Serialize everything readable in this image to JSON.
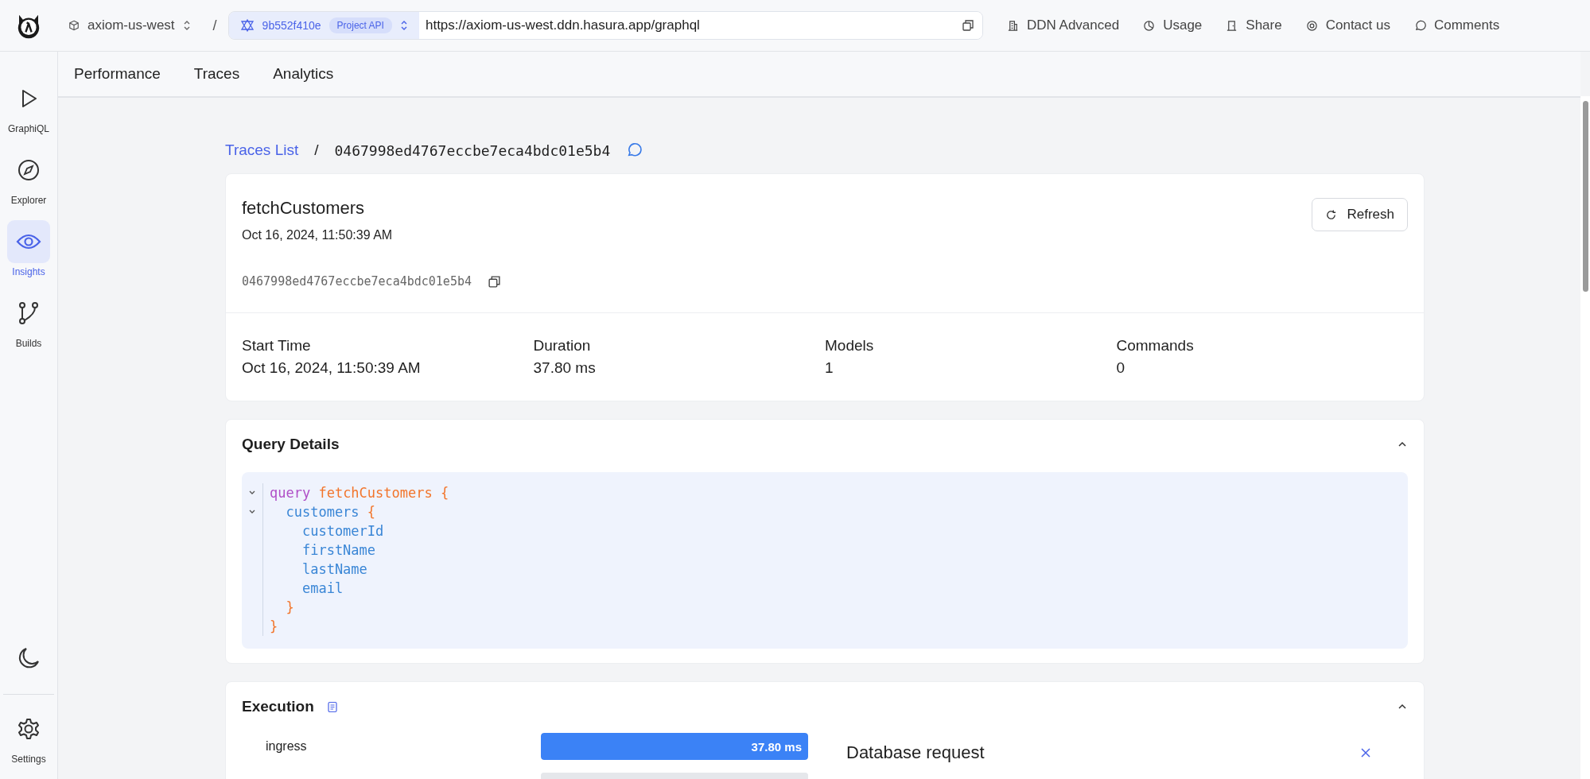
{
  "topbar": {
    "project": "axiom-us-west",
    "separator": "/",
    "build_id": "9b552f410e",
    "build_badge": "Project API",
    "url": "https://axiom-us-west.ddn.hasura.app/graphql",
    "actions": [
      {
        "kind": "plan",
        "label": "DDN Advanced"
      },
      {
        "kind": "usage",
        "label": "Usage"
      },
      {
        "kind": "share",
        "label": "Share"
      },
      {
        "kind": "contact",
        "label": "Contact us"
      },
      {
        "kind": "comments",
        "label": "Comments"
      }
    ]
  },
  "sidebar": {
    "items": [
      {
        "kind": "graphiql",
        "label": "GraphiQL",
        "selected": false
      },
      {
        "kind": "explorer",
        "label": "Explorer",
        "selected": false
      },
      {
        "kind": "insights",
        "label": "Insights",
        "selected": true
      },
      {
        "kind": "builds",
        "label": "Builds",
        "selected": false
      }
    ],
    "settings": {
      "label": "Settings"
    }
  },
  "tabs": [
    {
      "label": "Performance"
    },
    {
      "label": "Traces"
    },
    {
      "label": "Analytics"
    }
  ],
  "breadcrumb": {
    "link": "Traces List",
    "separator": "/",
    "current": "0467998ed4767eccbe7eca4bdc01e5b4"
  },
  "trace": {
    "name": "fetchCustomers",
    "timestamp": "Oct 16, 2024, 11:50:39 AM",
    "id": "0467998ed4767eccbe7eca4bdc01e5b4",
    "refresh": "Refresh",
    "stats": [
      {
        "label": "Start Time",
        "value": "Oct 16, 2024, 11:50:39 AM"
      },
      {
        "label": "Duration",
        "value": "37.80 ms"
      },
      {
        "label": "Models",
        "value": "1"
      },
      {
        "label": "Commands",
        "value": "0"
      }
    ]
  },
  "query": {
    "title": "Query Details",
    "expanded": true,
    "lines": [
      {
        "foldable": true,
        "tokens": [
          {
            "kind": "keyword",
            "text": "query"
          },
          {
            "kind": "name",
            "text": " fetchCustomers"
          },
          {
            "kind": "punct",
            "text": " {"
          }
        ]
      },
      {
        "foldable": true,
        "tokens": [
          {
            "kind": "field",
            "text": "  customers"
          },
          {
            "kind": "punct",
            "text": " {"
          }
        ]
      },
      {
        "foldable": false,
        "tokens": [
          {
            "kind": "field",
            "text": "    customerId"
          }
        ]
      },
      {
        "foldable": false,
        "tokens": [
          {
            "kind": "field",
            "text": "    firstName"
          }
        ]
      },
      {
        "foldable": false,
        "tokens": [
          {
            "kind": "field",
            "text": "    lastName"
          }
        ]
      },
      {
        "foldable": false,
        "tokens": [
          {
            "kind": "field",
            "text": "    email"
          }
        ]
      },
      {
        "foldable": false,
        "tokens": [
          {
            "kind": "punct",
            "text": "  }"
          }
        ]
      },
      {
        "foldable": false,
        "tokens": [
          {
            "kind": "punct",
            "text": "}"
          }
        ]
      }
    ]
  },
  "execution": {
    "title": "Execution",
    "expanded": true,
    "spans": [
      {
        "name": "ingress",
        "reading": "37.80 ms",
        "level": 1,
        "selected": true
      },
      {
        "level": 1,
        "selected": false
      }
    ],
    "panel": {
      "title": "Database request"
    }
  }
}
